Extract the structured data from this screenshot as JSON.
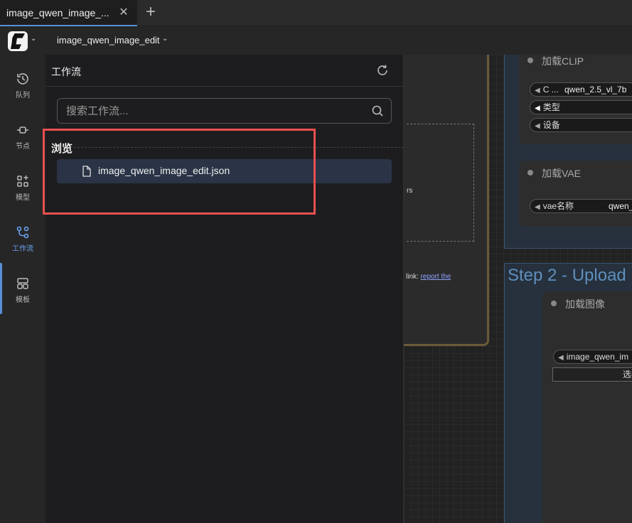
{
  "tabs": [
    {
      "title": "image_qwen_image_...",
      "active": true
    }
  ],
  "tab_close_icon": "close-icon",
  "tab_add_icon": "plus-icon",
  "workflow_menu": {
    "name": "image_qwen_image_edit",
    "caret": "⌄"
  },
  "sidebar": {
    "items": [
      {
        "label": "队列",
        "icon": "history-icon"
      },
      {
        "label": "节点",
        "icon": "node-icon"
      },
      {
        "label": "模型",
        "icon": "model-icon"
      },
      {
        "label": "工作流",
        "icon": "workflow-icon",
        "active": true
      },
      {
        "label": "模板",
        "icon": "template-icon"
      }
    ]
  },
  "workflow_panel": {
    "title": "工作流",
    "refresh_icon": "refresh-icon",
    "search": {
      "placeholder": "搜索工作流..."
    },
    "section_label": "浏览",
    "files": [
      {
        "name": "image_qwen_image_edit.json",
        "icon": "file-icon"
      }
    ]
  },
  "highlight_color": "#e8504f",
  "accent_color": "#5b8ed6",
  "canvas": {
    "note": {
      "text_fragment": "rs",
      "link_prefix": "link: ",
      "link_text": "report the"
    },
    "clip_node": {
      "title": "加载CLIP",
      "widgets": [
        {
          "label": "C ...",
          "value": "qwen_2.5_vl_7b"
        },
        {
          "label": "类型",
          "value": ""
        },
        {
          "label": "设备",
          "value": ""
        }
      ]
    },
    "vae_node": {
      "title": "加载VAE",
      "widgets": [
        {
          "label": "vae名称",
          "value": "qwen_"
        }
      ]
    },
    "group_title": "Step 2 - Upload",
    "image_node": {
      "title": "加载图像",
      "widget_value": "image_qwen_im",
      "button_label": "选择"
    }
  }
}
